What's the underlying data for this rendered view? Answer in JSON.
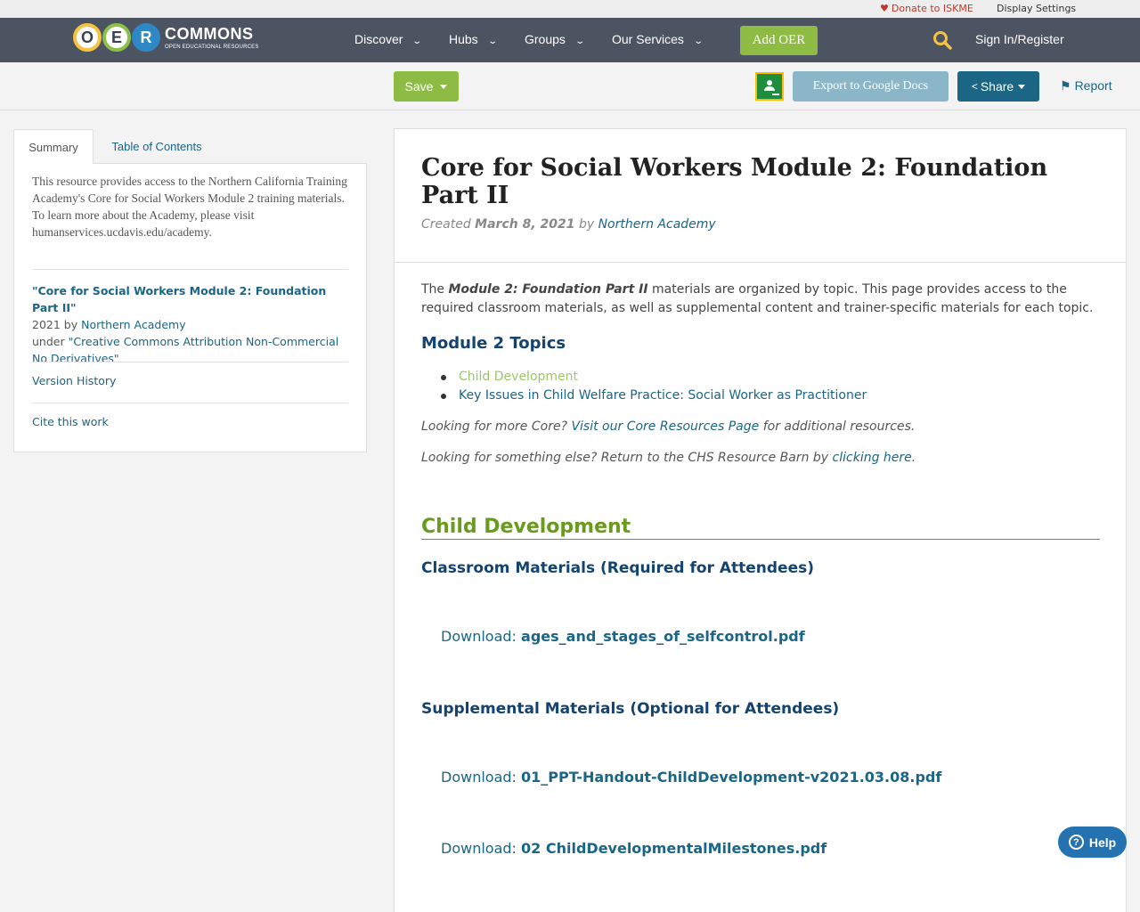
{
  "utility": {
    "donate": "Donate to ISKME",
    "display_settings": "Display Settings"
  },
  "logo": {
    "letters": [
      "O",
      "E",
      "R"
    ],
    "name": "COMMONS",
    "tagline": "OPEN EDUCATIONAL RESOURCES"
  },
  "nav": {
    "items": [
      {
        "label": "Discover"
      },
      {
        "label": "Hubs"
      },
      {
        "label": "Groups"
      },
      {
        "label": "Our Services"
      }
    ],
    "add_oer": "Add OER",
    "signin": "Sign In/Register"
  },
  "toolbar": {
    "save": "Save",
    "export": "Export to Google Docs",
    "share": "Share",
    "report": "Report"
  },
  "sidebar": {
    "tabs": {
      "summary": "Summary",
      "toc": "Table of Contents"
    },
    "description": "This resource provides access to the Northern California Training Academy's Core for Social Workers Module 2 training materials. To learn more about the Academy, please visit humanservices.ucdavis.edu/academy.",
    "citation": {
      "title": "\"Core for Social Workers Module 2: Foundation Part II\"",
      "year_by": "2021 by ",
      "author": "Northern Academy",
      "under": "under ",
      "license": "\"Creative Commons Attribution Non-Commercial No Derivatives\""
    },
    "version_history": "Version History",
    "cite": "Cite this work"
  },
  "main": {
    "title": "Core for Social Workers Module 2: Foundation Part II",
    "created_label": "Created ",
    "created_date": "March 8, 2021",
    "by_label": " by ",
    "author": "Northern Academy",
    "intro_pre": "The ",
    "intro_bold": "Module 2: Foundation Part II",
    "intro_post": " materials are organized by topic. This page provides access to the required classroom materials, as well as supplemental content and trainer-specific materials for each topic.",
    "topics_heading": "Module 2 Topics",
    "topics": [
      "Child Development",
      "Key Issues in Child Welfare Practice: Social Worker as Practitioner"
    ],
    "more_core_pre": "Looking for more Core? ",
    "more_core_link": "Visit our Core Resources Page",
    "more_core_post": " for additional resources.",
    "else_pre": "Looking for something else? Return to the CHS Resource Barn by ",
    "else_link": "clicking here",
    "else_post": ".",
    "section_title": "Child Development",
    "classroom_heading": "Classroom Materials (Required for Attendees)",
    "supplemental_heading": "Supplemental Materials (Optional for Attendees)",
    "download_label": "Download: ",
    "downloads": [
      "ages_and_stages_of_selfcontrol.pdf",
      "01_PPT-Handout-ChildDevelopment-v2021.03.08.pdf",
      "02 ChildDevelopmentalMilestones.pdf"
    ]
  },
  "help": "Help",
  "colors": {
    "nav_bg": "#4c5462",
    "green": "#8dbb43",
    "link": "#1b6585",
    "heading": "#13436e",
    "section_green": "#6a9b1f"
  }
}
